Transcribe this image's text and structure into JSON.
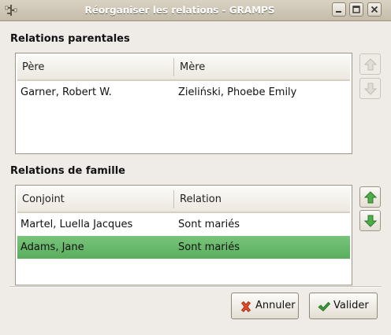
{
  "window": {
    "title": "Réorganiser les relations - GRAMPS"
  },
  "parents_section": {
    "title": "Relations parentales",
    "columns": [
      "Père",
      "Mère"
    ],
    "rows": [
      [
        "Garner, Robert W.",
        "Zieliński, Phoebe Emily"
      ]
    ]
  },
  "family_section": {
    "title": "Relations de famille",
    "columns": [
      "Conjoint",
      "Relation"
    ],
    "rows": [
      [
        "Martel, Luella Jacques",
        "Sont mariés"
      ],
      [
        "Adams, Jane",
        "Sont mariés"
      ]
    ],
    "selected_row": 1
  },
  "buttons": {
    "cancel": "Annuler",
    "ok": "Valider"
  },
  "icons": {
    "up": "up-arrow-icon",
    "down": "down-arrow-icon",
    "cancel": "red-x-icon",
    "ok": "green-check-icon"
  },
  "colors": {
    "selection": "#66b668",
    "arrow_green": "#3c9a38",
    "cancel_red": "#d23a1f"
  }
}
